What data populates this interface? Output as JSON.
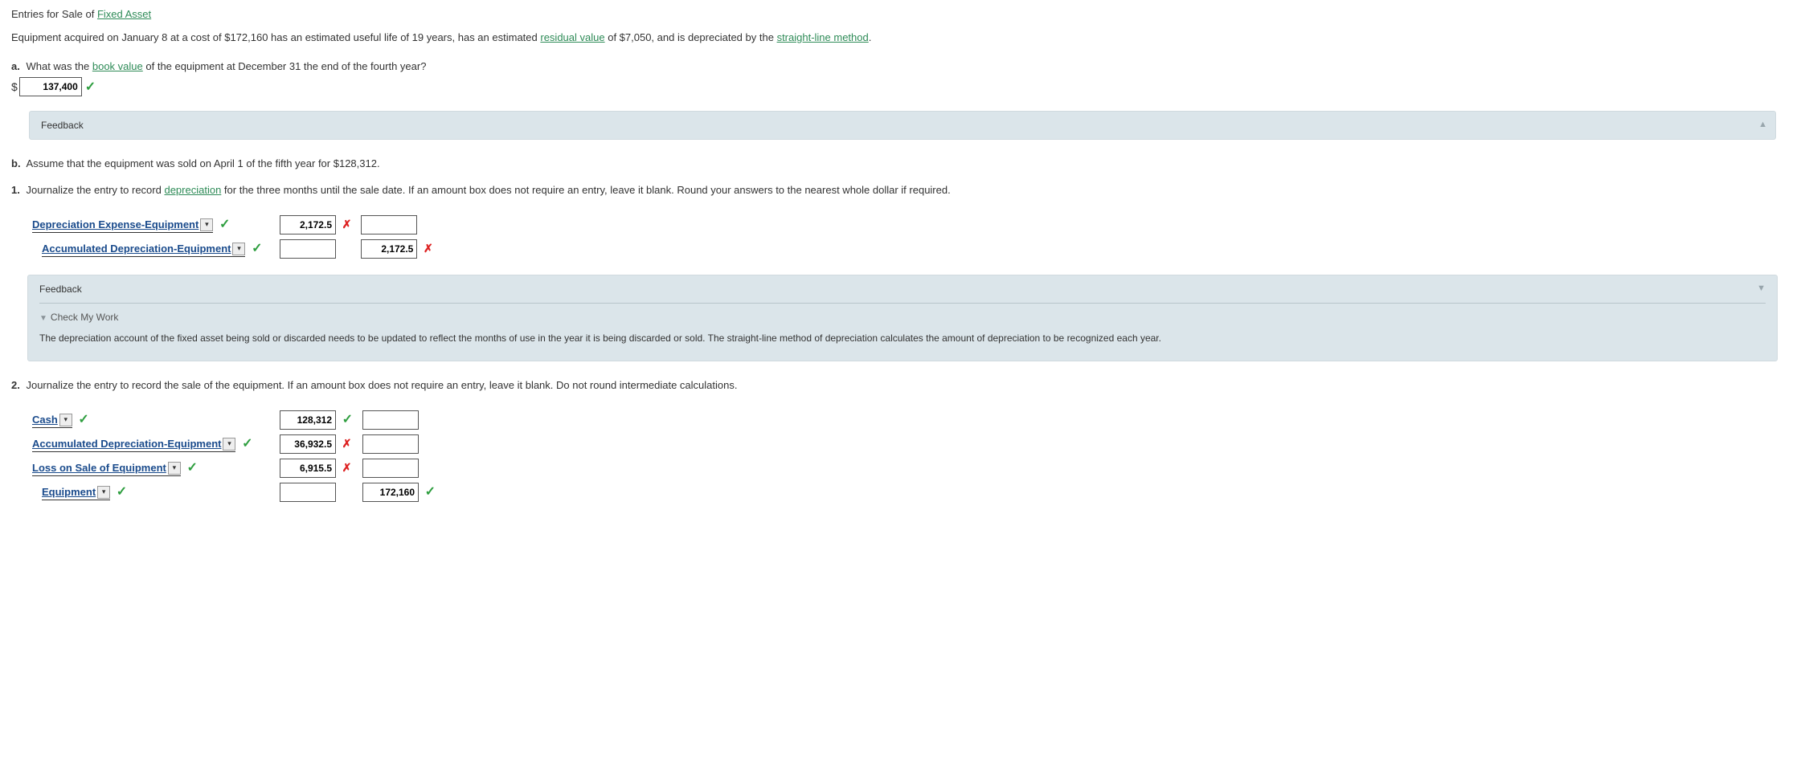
{
  "title": {
    "prefix": "Entries for Sale of",
    "link": "Fixed Asset"
  },
  "intro": {
    "t1": "Equipment acquired on January 8 at a cost of $172,160 has an estimated useful life of 19 years, has an estimated",
    "link1": "residual value",
    "t2": "of $7,050, and is depreciated by the",
    "link2": "straight-line method",
    "t3": "."
  },
  "a": {
    "label": "a.",
    "q1": "What was the",
    "link": "book value",
    "q2": "of the equipment at December 31 the end of the fourth year?",
    "answer": "137,400"
  },
  "feedback_label": "Feedback",
  "b": {
    "label": "b.",
    "text": "Assume that the equipment was sold on April 1 of the fifth year for $128,312."
  },
  "b1": {
    "label": "1.",
    "t1": "Journalize the entry to record",
    "link": "depreciation",
    "t2": "for the three months until the sale date. If an amount box does not require an entry, leave it blank. Round your answers to the nearest whole dollar if required.",
    "rows": [
      {
        "acct": "Depreciation Expense-Equipment",
        "debit": "2,172.5",
        "credit": "",
        "d_mark": "cross",
        "c_mark": ""
      },
      {
        "acct": "Accumulated Depreciation-Equipment",
        "debit": "",
        "credit": "2,172.5",
        "d_mark": "",
        "c_mark": "cross"
      }
    ]
  },
  "cmw": {
    "label": "Check My Work",
    "hint": "The depreciation account of the fixed asset being sold or discarded needs to be updated to reflect the months of use in the year it is being discarded or sold. The straight-line method of depreciation calculates the amount of depreciation to be recognized each year."
  },
  "b2": {
    "label": "2.",
    "text": "Journalize the entry to record the sale of the equipment. If an amount box does not require an entry, leave it blank. Do not round intermediate calculations.",
    "rows": [
      {
        "acct": "Cash",
        "debit": "128,312",
        "credit": "",
        "d_mark": "check",
        "c_mark": ""
      },
      {
        "acct": "Accumulated Depreciation-Equipment",
        "debit": "36,932.5",
        "credit": "",
        "d_mark": "cross",
        "c_mark": ""
      },
      {
        "acct": "Loss on Sale of Equipment",
        "debit": "6,915.5",
        "credit": "",
        "d_mark": "cross",
        "c_mark": ""
      },
      {
        "acct": "Equipment",
        "debit": "",
        "credit": "172,160",
        "d_mark": "",
        "c_mark": "check"
      }
    ]
  }
}
